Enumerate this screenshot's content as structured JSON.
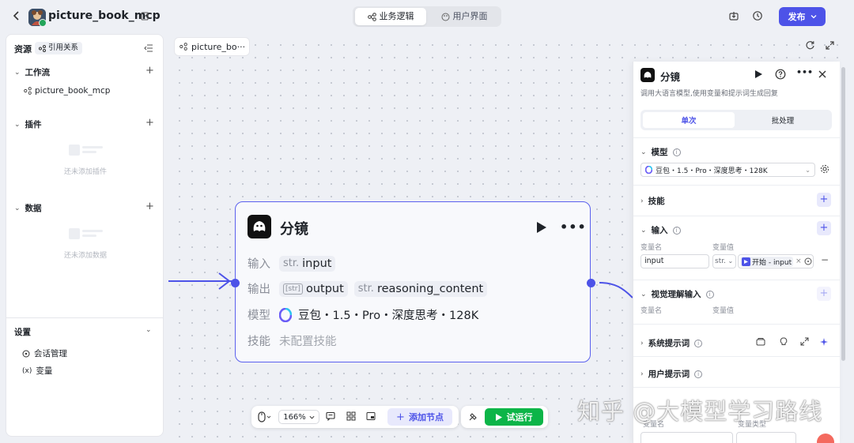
{
  "topbar": {
    "app_title": "picture_book_mcp",
    "tabs": [
      {
        "label": "业务逻辑",
        "active": true
      },
      {
        "label": "用户界面",
        "active": false
      }
    ],
    "publish_label": "发布"
  },
  "left_panel": {
    "header": "资源",
    "ref_tag": "引用关系",
    "workflow": {
      "label": "工作流",
      "items": [
        "picture_book_mcp"
      ]
    },
    "plugins": {
      "label": "插件",
      "empty_text": "还未添加插件"
    },
    "data": {
      "label": "数据",
      "empty_text": "还未添加数据"
    },
    "settings": {
      "label": "设置",
      "items": [
        "会话管理",
        "变量"
      ]
    }
  },
  "canvas": {
    "tab_label": "picture_bo···",
    "node": {
      "title": "分镜",
      "rows": {
        "input_label": "输入",
        "input_type": "str.",
        "input_value": "input",
        "output_label": "输出",
        "output_type1": "[str]",
        "output_value1": "output",
        "output_type2": "str.",
        "output_value2": "reasoning_content",
        "model_label": "模型",
        "model_value": "豆包・1.5・Pro・深度思考・128K",
        "skill_label": "技能",
        "skill_value": "未配置技能"
      }
    },
    "toolbar": {
      "zoom": "166%",
      "add_node_label": "添加节点",
      "run_label": "试运行"
    }
  },
  "right_panel": {
    "title": "分镜",
    "description": "调用大语言模型,使用变量和提示词生成回复",
    "modes": [
      {
        "label": "单次",
        "active": true
      },
      {
        "label": "批处理",
        "active": false
      }
    ],
    "model_section": {
      "label": "模型",
      "selected": "豆包・1.5・Pro・深度思考・128K"
    },
    "skill_section": {
      "label": "技能"
    },
    "input_section": {
      "label": "输入",
      "col_name": "变量名",
      "col_value": "变量值",
      "var_name": "input",
      "var_type": "str.",
      "ref_source": "开始 - input"
    },
    "vision_section": {
      "label": "视觉理解输入",
      "col_name": "变量名",
      "col_value": "变量值"
    },
    "system_prompt": {
      "label": "系统提示词"
    },
    "user_prompt": {
      "label": "用户提示词"
    },
    "output_section": {
      "col_name": "变量名",
      "col_type": "变量类型"
    }
  },
  "watermark": "知乎 @大模型学习路线",
  "colors": {
    "accent": "#4d53e8",
    "run_green": "#0cb548",
    "canvas_bg": "#eef0f5"
  }
}
